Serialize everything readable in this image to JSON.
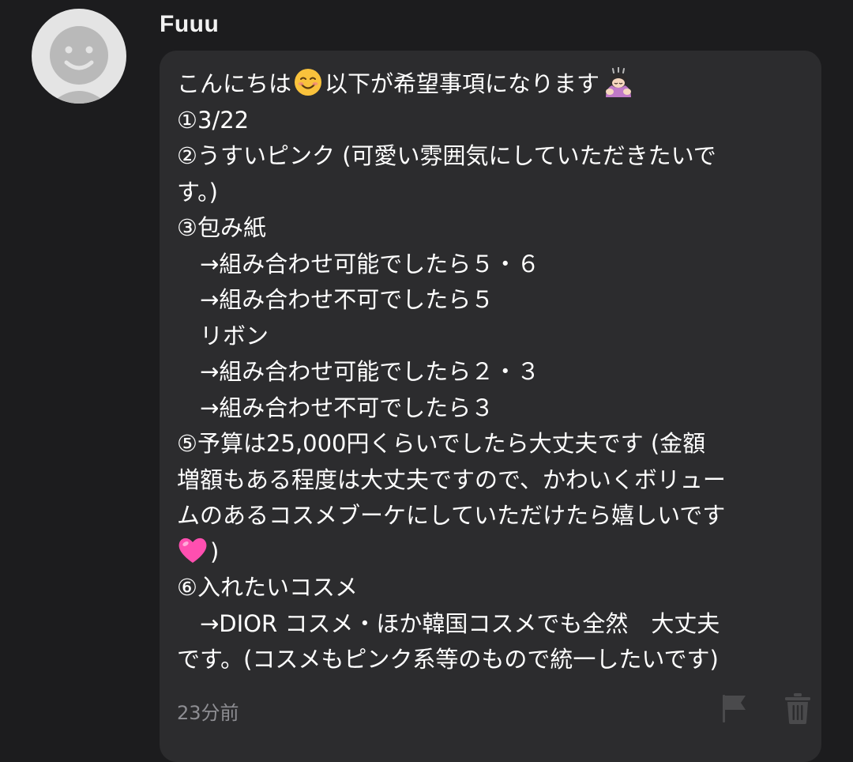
{
  "comment": {
    "username": "Fuuu",
    "avatar_icon": "default-user-avatar-icon",
    "timestamp": "23分前",
    "lines": [
      {
        "before": "こんにちは",
        "emoji": "smiling-face-emoji",
        "after": "以下が希望事項になります",
        "emoji2": "bowing-woman-emoji"
      },
      {
        "text": "①3/22"
      },
      {
        "text": "②うすいピンク (可愛い雰囲気にしていただきたいで"
      },
      {
        "text": "す。)"
      },
      {
        "text": "③包み紙"
      },
      {
        "text": "　→組み合わせ可能でしたら５・６"
      },
      {
        "text": "　→組み合わせ不可でしたら５"
      },
      {
        "text": "　リボン"
      },
      {
        "text": "　→組み合わせ可能でしたら２・３"
      },
      {
        "text": "　→組み合わせ不可でしたら３"
      },
      {
        "text": "⑤予算は25,000円くらいでしたら大丈夫です (金額"
      },
      {
        "text": "増額もある程度は大丈夫ですので、かわいくボリュー"
      },
      {
        "text": "ムのあるコスメブーケにしていただけたら嬉しいです"
      },
      {
        "emoji": "pink-heart-emoji",
        "after": ")"
      },
      {
        "text": "⑥入れたいコスメ"
      },
      {
        "text": "　→DIOR コスメ・ほか韓国コスメでも全然　大丈夫"
      },
      {
        "text": "です。(コスメもピンク系等のもので統一したいです)"
      }
    ]
  },
  "actions": {
    "flag_icon": "flag-icon",
    "trash_icon": "trash-icon"
  },
  "colors": {
    "background": "#1c1c1e",
    "bubble": "#2c2c2e",
    "text": "#ffffff",
    "muted": "#8e8e93",
    "icon": "#4a4a4c",
    "heart": "#ff4fb0",
    "smile": "#f9c23c"
  }
}
